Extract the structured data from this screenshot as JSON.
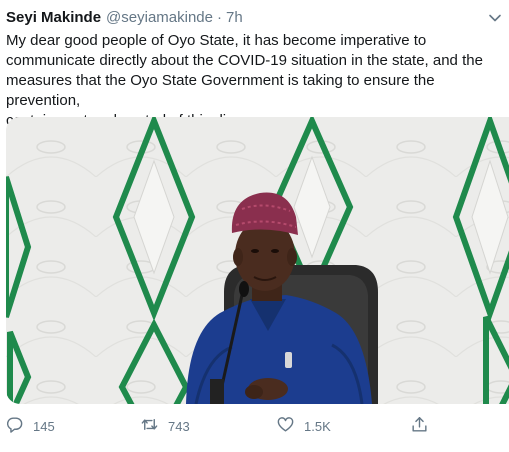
{
  "tweet": {
    "author_name": "Seyi Makinde",
    "author_handle": "@seyiamakinde",
    "separator": "·",
    "time": "7h",
    "text": "My dear good people of Oyo State, it has become imperative to\ncommunicate directly about the COVID-19 situation in the state, and the\nmeasures that the Oyo State Government is taking to ensure the prevention,\ncontainment and control of this disease."
  },
  "icons": {
    "menu": "chevron-down-icon",
    "reply": "reply-icon",
    "retweet": "retweet-icon",
    "like": "heart-icon",
    "share": "share-icon"
  },
  "actions": {
    "reply_count": "145",
    "retweet_count": "743",
    "like_count": "1.5K"
  },
  "colors": {
    "name": "#14171a",
    "secondary": "#657786",
    "accent_green": "#1f8a4c",
    "wall": "#ececea",
    "shirt": "#1c3d8f",
    "cap": "#8a2f4e"
  }
}
